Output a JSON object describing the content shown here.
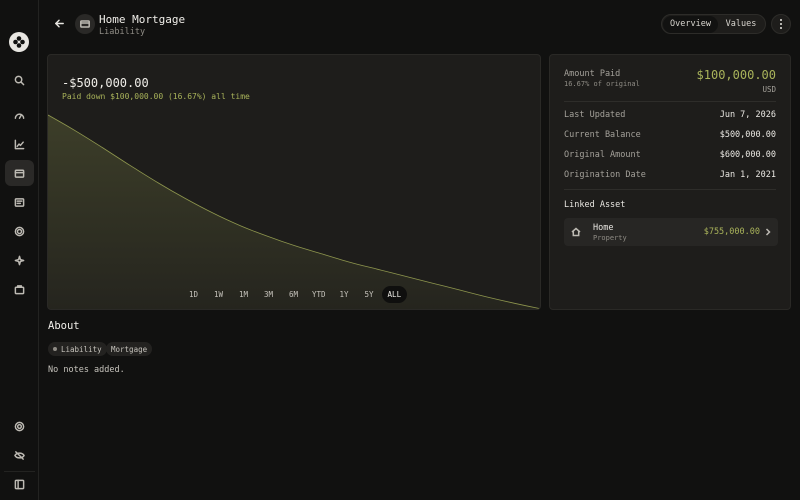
{
  "header": {
    "title": "Home Mortgage",
    "subtitle": "Liability",
    "tabs": [
      {
        "label": "Overview",
        "active": true
      },
      {
        "label": "Values",
        "active": false
      }
    ]
  },
  "sidebar": {
    "items": [
      {
        "name": "search",
        "icon": "search-icon"
      },
      {
        "name": "dashboard",
        "icon": "gauge-icon"
      },
      {
        "name": "reports",
        "icon": "line-chart-icon"
      },
      {
        "name": "accounts",
        "icon": "wallet-icon",
        "active": true
      },
      {
        "name": "transactions",
        "icon": "receipt-icon"
      },
      {
        "name": "goals",
        "icon": "target-icon"
      },
      {
        "name": "ai",
        "icon": "sparkles-icon"
      },
      {
        "name": "budget",
        "icon": "briefcase-icon"
      },
      {
        "name": "settings",
        "icon": "gear-icon"
      },
      {
        "name": "privacy",
        "icon": "eye-off-icon"
      },
      {
        "name": "collapse",
        "icon": "sidebar-toggle-icon"
      }
    ]
  },
  "chart": {
    "value": "-$500,000.00",
    "note": "Paid down $100,000.00 (16.67%) all time",
    "ranges": [
      "1D",
      "1W",
      "1M",
      "3M",
      "6M",
      "YTD",
      "1Y",
      "5Y",
      "ALL"
    ],
    "active_range": "ALL",
    "accent_color": "#a9b35a"
  },
  "chart_data": {
    "type": "area",
    "values": [
      600000,
      575000,
      548000,
      520000,
      493000,
      468000,
      445000,
      425000,
      408000,
      393000,
      380000,
      367000,
      356000,
      345000,
      334000,
      323000,
      312000,
      302000,
      293000
    ],
    "title": "",
    "xlabel": "",
    "ylabel": "",
    "grid": false
  },
  "summary": {
    "amount_paid_label": "Amount Paid",
    "amount_paid_sub": "16.67% of original",
    "amount_paid_value": "$100,000.00",
    "currency": "USD",
    "rows": [
      {
        "label": "Last Updated",
        "value": "Jun 7, 2026"
      },
      {
        "label": "Current Balance",
        "value": "$500,000.00"
      },
      {
        "label": "Original Amount",
        "value": "$600,000.00"
      },
      {
        "label": "Origination Date",
        "value": "Jan 1, 2021"
      }
    ],
    "linked_title": "Linked Asset",
    "linked_asset": {
      "name": "Home",
      "type": "Property",
      "value": "$755,000.00"
    }
  },
  "about": {
    "title": "About",
    "tags": [
      "Liability",
      "Mortgage"
    ],
    "notes": "No notes added."
  }
}
